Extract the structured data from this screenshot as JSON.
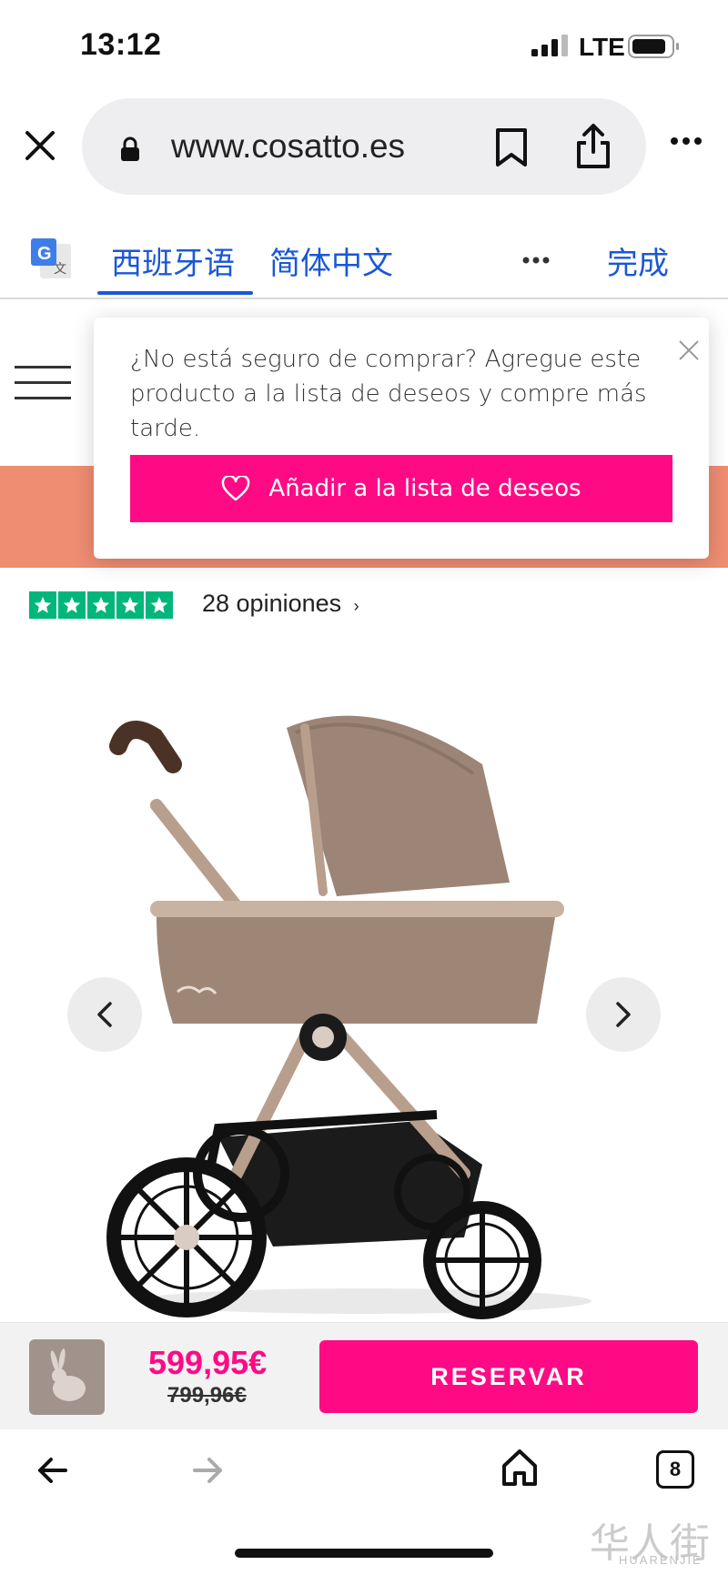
{
  "status_bar": {
    "time": "13:12",
    "network": "LTE"
  },
  "browser": {
    "url": "www.cosatto.es"
  },
  "translate_bar": {
    "source_lang": "西班牙语",
    "target_lang": "简体中文",
    "done_label": "完成"
  },
  "popup": {
    "message": "¿No está seguro de comprar? Agregue este producto a la lista de deseos y compre más tarde.",
    "wishlist_button": "Añadir a la lista de deseos"
  },
  "reviews": {
    "stars": 5,
    "count_label": "28 opiniones",
    "star_color": "#00b67a"
  },
  "buy_bar": {
    "price": "599,95€",
    "old_price": "799,96€",
    "reserve_label": "RESERVAR"
  },
  "bottom_nav": {
    "tab_count": "8"
  },
  "watermark": {
    "chars": "华人街",
    "latin": "HUARENJIE"
  },
  "colors": {
    "accent": "#ff0a85",
    "banner": "#ee8d72",
    "link": "#1a57d6"
  }
}
